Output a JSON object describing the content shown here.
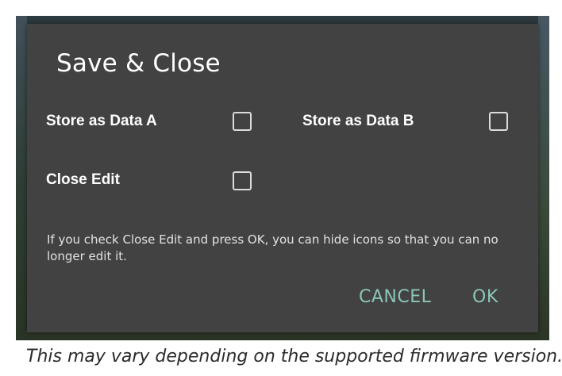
{
  "dialog": {
    "title": "Save & Close",
    "options": {
      "store_a_label": "Store as Data A",
      "store_b_label": "Store as Data B",
      "close_edit_label": "Close Edit"
    },
    "description": "If you check Close Edit and press OK, you can hide icons so that you can no longer edit it.",
    "cancel_label": "CANCEL",
    "ok_label": "OK"
  },
  "caption": "This may vary depending on the supported firmware version.",
  "colors": {
    "dialog_bg": "#424242",
    "button_text": "#8ac6b8",
    "checkbox_border": "#dcdcdc"
  }
}
